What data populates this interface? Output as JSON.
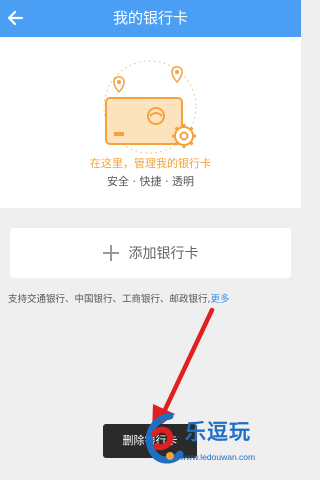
{
  "header": {
    "title": "我的银行卡"
  },
  "hero": {
    "tagline": "在这里，管理我的银行卡",
    "features": "安全 · 快捷 · 透明"
  },
  "add_card": {
    "label": "添加银行卡"
  },
  "supported_banks": {
    "text": "支持交通银行、中国银行、工商银行、邮政银行,",
    "more": "更多"
  },
  "popup": {
    "delete_label": "删除银行卡"
  },
  "watermark": {
    "brand": "乐逗玩",
    "domain": "www.ledouwan.com"
  },
  "colors": {
    "header": "#4a9ff5",
    "illustration": "#f4a23b",
    "link": "#3d8ee9",
    "arrow": "#e02020",
    "watermark": "#1f6fc1"
  }
}
